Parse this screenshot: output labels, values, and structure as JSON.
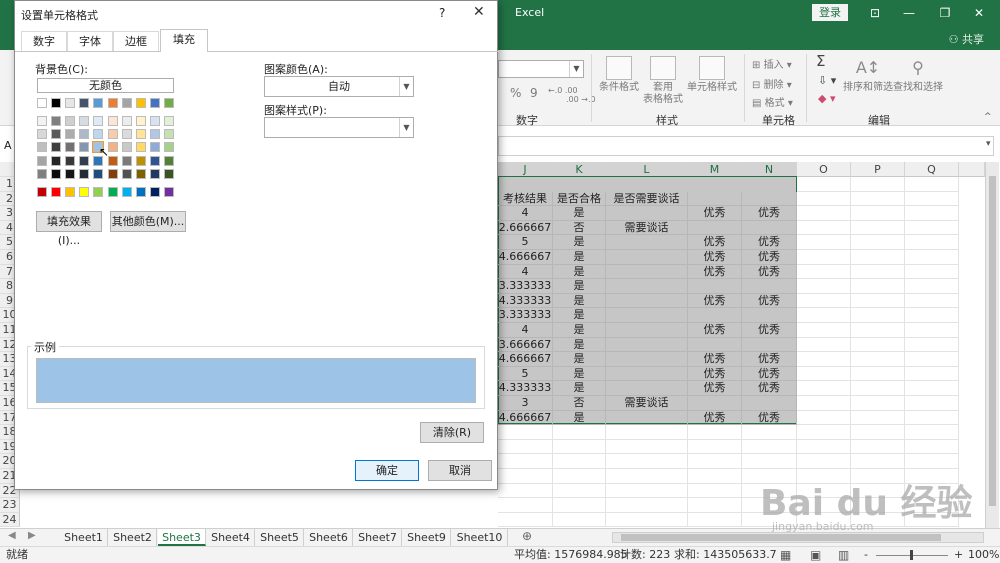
{
  "window": {
    "app_title": "Excel",
    "login_label": "登录",
    "share_label": "共享",
    "min_glyph": "—",
    "max_glyph": "❐",
    "close_glyph": "✕"
  },
  "ribbon": {
    "groups": {
      "number": "数字",
      "styles": "样式",
      "cells": "单元格",
      "editing": "编辑"
    },
    "number_percent": "%",
    "number_comma": "9",
    "number_incdec_1": "←.0 .00",
    "number_incdec_2": ".00 →.0",
    "btn_conditional": "条件格式",
    "btn_table_1": "套用",
    "btn_table_2": "表格格式",
    "btn_cellstyle": "单元格样式",
    "btn_insert": "插入",
    "btn_delete": "删除",
    "btn_format": "格式",
    "btn_sum_glyph": "Σ",
    "btn_sort": "排序和筛选",
    "btn_find": "查找和选择"
  },
  "formula_bar": {
    "name_box_char": "A"
  },
  "grid": {
    "columns": [
      "J",
      "K",
      "L",
      "M",
      "N",
      "O",
      "P",
      "Q"
    ],
    "rows": [
      "1",
      "2",
      "3",
      "4",
      "5",
      "6",
      "7",
      "8",
      "9",
      "10",
      "11",
      "12",
      "13",
      "14",
      "15",
      "16",
      "17",
      "18",
      "19",
      "20",
      "21",
      "22",
      "23",
      "24"
    ],
    "header": [
      "考核结果",
      "是否合格",
      "是否需要谈话",
      "",
      ""
    ],
    "data": [
      [
        "4",
        "是",
        "",
        "优秀",
        "优秀"
      ],
      [
        "2.666667",
        "否",
        "需要谈话",
        "",
        ""
      ],
      [
        "5",
        "是",
        "",
        "优秀",
        "优秀"
      ],
      [
        "4.666667",
        "是",
        "",
        "优秀",
        "优秀"
      ],
      [
        "4",
        "是",
        "",
        "优秀",
        "优秀"
      ],
      [
        "3.333333",
        "是",
        "",
        "",
        ""
      ],
      [
        "4.333333",
        "是",
        "",
        "优秀",
        "优秀"
      ],
      [
        "3.333333",
        "是",
        "",
        "",
        ""
      ],
      [
        "4",
        "是",
        "",
        "优秀",
        "优秀"
      ],
      [
        "3.666667",
        "是",
        "",
        "",
        ""
      ],
      [
        "4.666667",
        "是",
        "",
        "优秀",
        "优秀"
      ],
      [
        "5",
        "是",
        "",
        "优秀",
        "优秀"
      ],
      [
        "4.333333",
        "是",
        "",
        "优秀",
        "优秀"
      ],
      [
        "3",
        "否",
        "需要谈话",
        "",
        ""
      ],
      [
        "4.666667",
        "是",
        "",
        "优秀",
        "优秀"
      ]
    ]
  },
  "sheets": [
    "Sheet1",
    "Sheet2",
    "Sheet3",
    "Sheet4",
    "Sheet5",
    "Sheet6",
    "Sheet7",
    "Sheet9",
    "Sheet10"
  ],
  "active_sheet": "Sheet3",
  "status": {
    "ready": "就绪",
    "average": "平均值: 1576984.985",
    "count": "计数: 223",
    "sum": "求和: 143505633.7",
    "zoom": "100%",
    "zoom_minus": "-",
    "zoom_plus": "+"
  },
  "dialog": {
    "title": "设置单元格格式",
    "help": "?",
    "close": "✕",
    "tabs": [
      "数字",
      "字体",
      "边框",
      "填充"
    ],
    "active_tab": "填充",
    "bg_color_label": "背景色(C):",
    "no_color_label": "无颜色",
    "pattern_color_label": "图案颜色(A):",
    "pattern_color_value": "自动",
    "pattern_style_label": "图案样式(P):",
    "pattern_style_value": "",
    "fill_effects_button": "填充效果(I)...",
    "more_colors_button": "其他颜色(M)...",
    "sample_label": "示例",
    "sample_color": "#9dc3e6",
    "clear_button": "清除(R)",
    "ok_button": "确定",
    "cancel_button": "取消",
    "palette_top": [
      "#ffffff",
      "#000000",
      "#e7e6e6",
      "#44546a",
      "#5b9bd5",
      "#ed7d31",
      "#a5a5a5",
      "#ffc000",
      "#4472c4",
      "#70ad47"
    ],
    "palette_tints": [
      [
        "#f2f2f2",
        "#7f7f7f",
        "#d0cece",
        "#d6dce4",
        "#deebf6",
        "#fbe5d5",
        "#ededed",
        "#fff2cc",
        "#d9e2f3",
        "#e2efd9"
      ],
      [
        "#d8d8d8",
        "#595959",
        "#aeabab",
        "#adb9ca",
        "#bdd7ee",
        "#f7cbac",
        "#dbdbdb",
        "#fee599",
        "#b4c6e7",
        "#c5e0b3"
      ],
      [
        "#bfbfbf",
        "#3f3f3f",
        "#757070",
        "#8496b0",
        "#9dc3e6",
        "#f4b183",
        "#c9c9c9",
        "#ffd965",
        "#8eaadb",
        "#a8d08d"
      ],
      [
        "#a5a5a5",
        "#262626",
        "#3a3838",
        "#323f4f",
        "#2e75b5",
        "#c55a11",
        "#7b7b7b",
        "#bf9000",
        "#2f5496",
        "#538135"
      ],
      [
        "#7f7f7f",
        "#0c0c0c",
        "#171616",
        "#222a35",
        "#1e4e79",
        "#833c0b",
        "#525252",
        "#7f6000",
        "#1f3864",
        "#375623"
      ]
    ],
    "palette_standard": [
      "#c00000",
      "#ff0000",
      "#ffc000",
      "#ffff00",
      "#92d050",
      "#00b050",
      "#00b0f0",
      "#0070c0",
      "#002060",
      "#7030a0"
    ]
  },
  "watermark": {
    "brand": "Bai du 经验",
    "url": "jingyan.baidu.com"
  }
}
